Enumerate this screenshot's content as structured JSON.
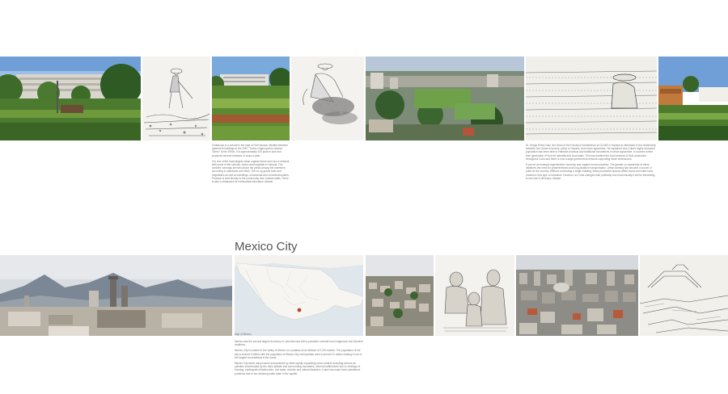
{
  "top_captions": {
    "left": [
      "Cuitlahuac is a suburb in the east of Old Havana. Nestled between apartment buildings in the 1967 \"Torres Organoponico Alamar Vivero\" is the 1990s. It is approximately 100 plots in size and produces several hectares of crops a year.",
      "It is one of the most largest urban organic farms and runs a network with some of the schools, clinics and hospitals in Havana. The workers' earnings are tied above the yields among the members according to standards and effort. The co-op grows fruits and vegetables as well as seedlings, ornamental and ornamental plants. Produce is sold directly to the community from modest stalls. There is also a restaurant for horticultural education. Alamar."
    ],
    "right": [
      "Dr. Sergio Pérez Díaz, the Dean of the Faculty of Architecture at CUJAE in Havana is interested in the relationship between the Cuban economy, policy of Havana, and urban agriculture. He explained how Cuba's highly educated population has been able to embrace practical and traditional innovations in urban agriculture, in sources where their generation of food sit naturally and local sales. This has enabled the local network of food production throughout Cuba and there is now a large government network supporting these endeavours.",
      "It can be an example regenerative economy and organic food production. The greater co-ownership of these initiatives the need for predetermined and long-distance transportation. Urban farming has become a source of pride for the country. Without commuting a single building, these productive spaces within towns and cities have created a new type of urbanism. However, as Cuba changes both politically and economically it will be interesting to see how it develops. Alamar."
    ]
  },
  "map": {
    "title": "Mexico City",
    "label": "Map of Mexico"
  },
  "bottom_caption": [
    "Mexico was the second largest economy in Latin America with a prevalent contrast from indigenous and Spanish traditions.",
    "Mexico City is located in the Valley of Mexico on a plateau at an altitude of 2,240 metres. The population of the city is around 9 million with the population of Mexico City metropolitan area is around 21 million making it one of the largest conurbations in the world.",
    "Mexico City faces many issues encountered by other rapidly expanding urban centres including serious air pollution exacerbated by the city's altitude and surrounding mountains, informal settlements due to shortage of housing, inadequate infrastructure, lost water, seismic and natural disasters. It also has major land subsidence problems due to the declining water table in the aquifer."
  ]
}
